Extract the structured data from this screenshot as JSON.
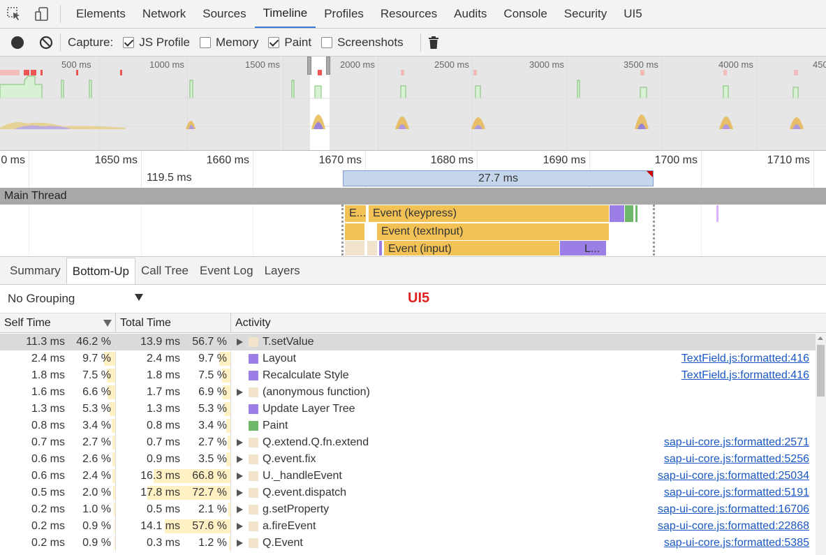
{
  "tabs": [
    "Elements",
    "Network",
    "Sources",
    "Timeline",
    "Profiles",
    "Resources",
    "Audits",
    "Console",
    "Security",
    "UI5"
  ],
  "active_tab": "Timeline",
  "capture": {
    "label": "Capture:",
    "js_profile": "JS Profile",
    "memory": "Memory",
    "paint": "Paint",
    "screenshots": "Screenshots"
  },
  "overview_ticks": [
    "500 ms",
    "1000 ms",
    "1500 ms",
    "2000 ms",
    "2500 ms",
    "3000 ms",
    "3500 ms",
    "4000 ms",
    "450"
  ],
  "ruler": {
    "ticks": [
      "0 ms",
      "1650 ms",
      "1660 ms",
      "1670 ms",
      "1680 ms",
      "1690 ms",
      "1700 ms",
      "1710 ms"
    ],
    "prev_duration": "119.5 ms",
    "selection_duration": "27.7 ms"
  },
  "main_thread_label": "Main Thread",
  "flame": {
    "e_short": "E...",
    "keypress": "Event (keypress)",
    "textinput": "Event (textInput)",
    "input": "Event (input)",
    "l_short": "L..."
  },
  "detail_tabs": [
    "Summary",
    "Bottom-Up",
    "Call Tree",
    "Event Log",
    "Layers"
  ],
  "active_detail_tab": "Bottom-Up",
  "grouping": "No Grouping",
  "badge": "UI5",
  "columns": {
    "self_time": "Self Time",
    "total_time": "Total Time",
    "activity": "Activity"
  },
  "colors": {
    "scripting": "#f2c256",
    "rendering": "#9b7fe6",
    "painting": "#6fb86a",
    "idle_light": "#f2e4cc",
    "link": "#1a57c4",
    "accent": "#3879d9"
  },
  "rows": [
    {
      "self_ms": "11.3 ms",
      "self_pct": "46.2 %",
      "self_frac": 0.462,
      "tot_ms": "13.9 ms",
      "tot_pct": "56.7 %",
      "tot_frac": 0.567,
      "expand": true,
      "swatch": "idle_light",
      "name": "T.setValue",
      "link": "",
      "selected": true
    },
    {
      "self_ms": "2.4 ms",
      "self_pct": "9.7 %",
      "self_frac": 0.097,
      "tot_ms": "2.4 ms",
      "tot_pct": "9.7 %",
      "tot_frac": 0.097,
      "expand": false,
      "swatch": "rendering",
      "name": "Layout",
      "link": "TextField.js:formatted:416"
    },
    {
      "self_ms": "1.8 ms",
      "self_pct": "7.5 %",
      "self_frac": 0.075,
      "tot_ms": "1.8 ms",
      "tot_pct": "7.5 %",
      "tot_frac": 0.075,
      "expand": false,
      "swatch": "rendering",
      "name": "Recalculate Style",
      "link": "TextField.js:formatted:416"
    },
    {
      "self_ms": "1.6 ms",
      "self_pct": "6.6 %",
      "self_frac": 0.066,
      "tot_ms": "1.7 ms",
      "tot_pct": "6.9 %",
      "tot_frac": 0.069,
      "expand": true,
      "swatch": "idle_light",
      "name": "(anonymous function)",
      "link": ""
    },
    {
      "self_ms": "1.3 ms",
      "self_pct": "5.3 %",
      "self_frac": 0.053,
      "tot_ms": "1.3 ms",
      "tot_pct": "5.3 %",
      "tot_frac": 0.053,
      "expand": false,
      "swatch": "rendering",
      "name": "Update Layer Tree",
      "link": ""
    },
    {
      "self_ms": "0.8 ms",
      "self_pct": "3.4 %",
      "self_frac": 0.034,
      "tot_ms": "0.8 ms",
      "tot_pct": "3.4 %",
      "tot_frac": 0.034,
      "expand": false,
      "swatch": "painting",
      "name": "Paint",
      "link": ""
    },
    {
      "self_ms": "0.7 ms",
      "self_pct": "2.7 %",
      "self_frac": 0.027,
      "tot_ms": "0.7 ms",
      "tot_pct": "2.7 %",
      "tot_frac": 0.027,
      "expand": true,
      "swatch": "idle_light",
      "name": "Q.extend.Q.fn.extend",
      "link": "sap-ui-core.js:formatted:2571"
    },
    {
      "self_ms": "0.6 ms",
      "self_pct": "2.6 %",
      "self_frac": 0.026,
      "tot_ms": "0.9 ms",
      "tot_pct": "3.5 %",
      "tot_frac": 0.035,
      "expand": true,
      "swatch": "idle_light",
      "name": "Q.event.fix",
      "link": "sap-ui-core.js:formatted:5256"
    },
    {
      "self_ms": "0.6 ms",
      "self_pct": "2.4 %",
      "self_frac": 0.024,
      "tot_ms": "16.3 ms",
      "tot_pct": "66.8 %",
      "tot_frac": 0.668,
      "expand": true,
      "swatch": "idle_light",
      "name": "U._handleEvent",
      "link": "sap-ui-core.js:formatted:25034"
    },
    {
      "self_ms": "0.5 ms",
      "self_pct": "2.0 %",
      "self_frac": 0.02,
      "tot_ms": "17.8 ms",
      "tot_pct": "72.7 %",
      "tot_frac": 0.727,
      "expand": true,
      "swatch": "idle_light",
      "name": "Q.event.dispatch",
      "link": "sap-ui-core.js:formatted:5191"
    },
    {
      "self_ms": "0.2 ms",
      "self_pct": "1.0 %",
      "self_frac": 0.01,
      "tot_ms": "0.5 ms",
      "tot_pct": "2.1 %",
      "tot_frac": 0.021,
      "expand": true,
      "swatch": "idle_light",
      "name": "g.setProperty",
      "link": "sap-ui-core.js:formatted:16706"
    },
    {
      "self_ms": "0.2 ms",
      "self_pct": "0.9 %",
      "self_frac": 0.009,
      "tot_ms": "14.1 ms",
      "tot_pct": "57.6 %",
      "tot_frac": 0.576,
      "expand": true,
      "swatch": "idle_light",
      "name": "a.fireEvent",
      "link": "sap-ui-core.js:formatted:22868"
    },
    {
      "self_ms": "0.2 ms",
      "self_pct": "0.9 %",
      "self_frac": 0.009,
      "tot_ms": "0.3 ms",
      "tot_pct": "1.2 %",
      "tot_frac": 0.012,
      "expand": true,
      "swatch": "idle_light",
      "name": "Q.Event",
      "link": "sap-ui-core.js:formatted:5385"
    }
  ]
}
